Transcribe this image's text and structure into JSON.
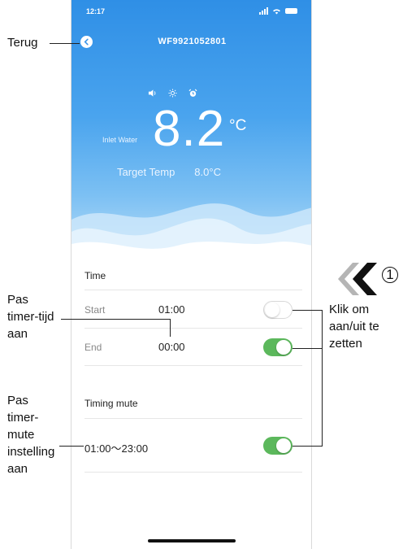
{
  "status_bar": {
    "time": "12:17"
  },
  "header": {
    "title": "WF9921052801"
  },
  "hero": {
    "inlet_label": "Inlet Water",
    "temperature": "8.2",
    "unit": "°C",
    "target_label": "Target Temp",
    "target_value": "8.0°C",
    "mode_icons": [
      "speaker-icon",
      "sun-icon",
      "alarm-clock-icon"
    ]
  },
  "time_section": {
    "title": "Time",
    "rows": [
      {
        "label": "Start",
        "value": "01:00",
        "enabled": false
      },
      {
        "label": "End",
        "value": "00:00",
        "enabled": true
      }
    ]
  },
  "mute_section": {
    "title": "Timing mute",
    "range": "01:00～23:00",
    "enabled": true
  },
  "annotations": {
    "back": "Terug",
    "timer_time_1": "Pas",
    "timer_time_2": "timer-tijd",
    "timer_time_3": "aan",
    "toggle_1": "Klik om",
    "toggle_2": "aan/uit te",
    "toggle_3": "zetten",
    "mute_1": "Pas",
    "mute_2": "timer-",
    "mute_3": "mute",
    "mute_4": "instelling",
    "mute_5": "aan",
    "step": "1"
  },
  "colors": {
    "accent_blue": "#2f8fe6",
    "toggle_on": "#5cb85c"
  }
}
